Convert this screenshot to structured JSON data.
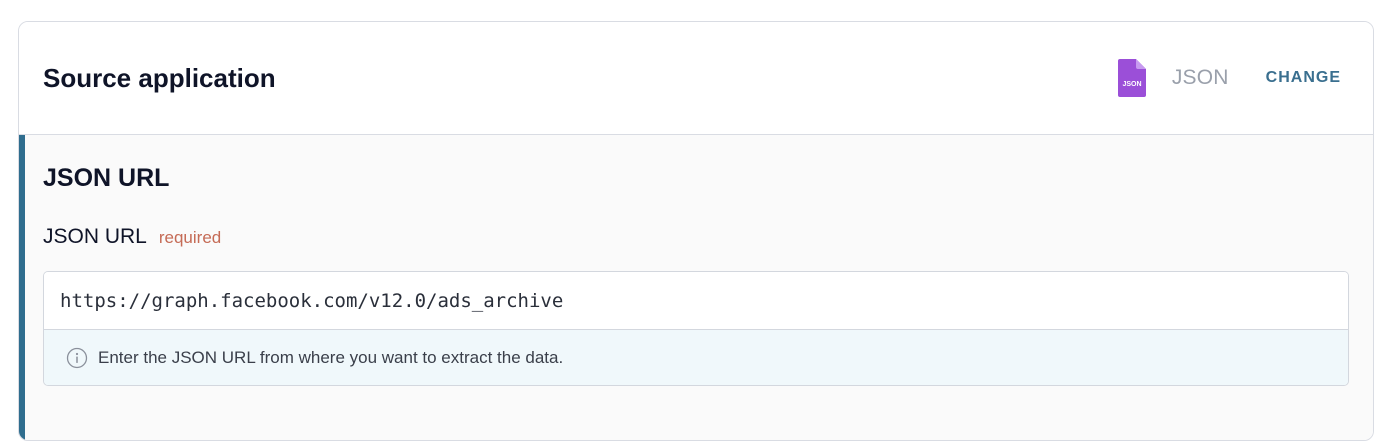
{
  "header": {
    "title": "Source application",
    "source_app_name": "JSON",
    "source_icon": "json-file-icon",
    "source_icon_label": "JSON",
    "change_label": "CHANGE"
  },
  "section": {
    "title": "JSON URL"
  },
  "field": {
    "label": "JSON URL",
    "required_text": "required",
    "value": "https://graph.facebook.com/v12.0/ads_archive",
    "helper_icon": "info-icon",
    "helper_text": "Enter the JSON URL from where you want to extract the data."
  },
  "colors": {
    "accent": "#2f6d8e",
    "change_text": "#3a6f8f",
    "required": "#c56b56",
    "json_icon": "#9b4fd8",
    "helper_bg": "#f0f8fb"
  }
}
